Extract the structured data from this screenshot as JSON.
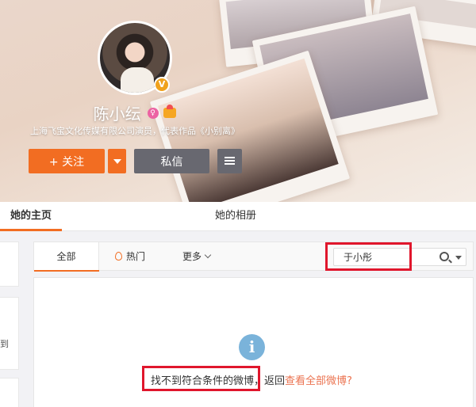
{
  "profile": {
    "name": "陈小纭",
    "description": "上海飞宝文化传媒有限公司演员，代表作品《小别离》",
    "verified_badge": "V",
    "gender_icon": "female-icon",
    "vip_icon": "vip-icon"
  },
  "actions": {
    "follow_label": "+ 关注",
    "message_label": "私信"
  },
  "tabs": [
    {
      "label": "她的主页",
      "active": true
    },
    {
      "label": "她的相册",
      "active": false
    }
  ],
  "filter": {
    "all_label": "全部",
    "hot_label": "热门",
    "more_label": "更多"
  },
  "search": {
    "value": "于小彤"
  },
  "empty_state": {
    "message": "找不到符合条件的微博，",
    "back_prefix": "返回",
    "link_text": "查看全部微博?"
  },
  "sidebar": {
    "fragment": "到"
  },
  "colors": {
    "accent": "#f26d22",
    "dark_button": "#686870",
    "link": "#eb7350",
    "highlight_box": "#e0162c",
    "info_icon": "#7ab3da"
  }
}
